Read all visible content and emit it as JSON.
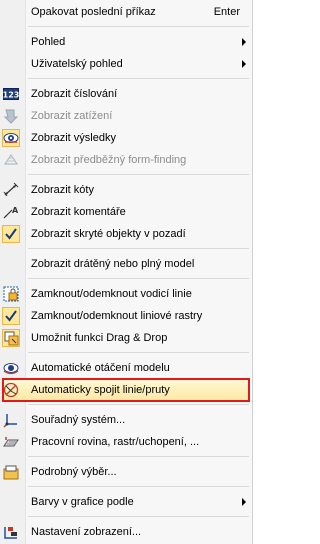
{
  "menu": {
    "items": [
      {
        "label": "Opakovat poslední příkaz",
        "shortcut": "Enter"
      },
      {
        "label": "Pohled"
      },
      {
        "label": "Uživatelský pohled"
      },
      {
        "label": "Zobrazit číslování"
      },
      {
        "label": "Zobrazit zatížení"
      },
      {
        "label": "Zobrazit výsledky"
      },
      {
        "label": "Zobrazit předběžný form-finding"
      },
      {
        "label": "Zobrazit kóty"
      },
      {
        "label": "Zobrazit komentáře"
      },
      {
        "label": "Zobrazit skryté objekty v pozadí"
      },
      {
        "label": "Zobrazit drátěný nebo plný model"
      },
      {
        "label": "Zamknout/odemknout vodicí linie"
      },
      {
        "label": "Zamknout/odemknout liniové rastry"
      },
      {
        "label": "Umožnit funkci Drag & Drop"
      },
      {
        "label": "Automatické otáčení modelu"
      },
      {
        "label": "Automaticky spojit linie/pruty"
      },
      {
        "label": "Souřadný systém..."
      },
      {
        "label": "Pracovní rovina, rastr/uchopení, ..."
      },
      {
        "label": "Podrobný výběr..."
      },
      {
        "label": "Barvy v grafice podle"
      },
      {
        "label": "Nastavení zobrazení..."
      }
    ]
  },
  "colors": {
    "highlight_border": "#e0191b",
    "checked_background": "#fde79a",
    "disabled_text": "#8c8c8c"
  }
}
